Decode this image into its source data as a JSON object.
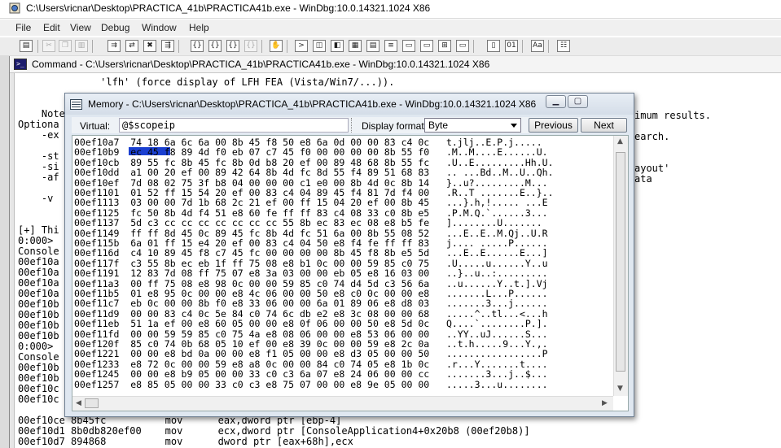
{
  "app": {
    "title": "C:\\Users\\ricnar\\Desktop\\PRACTICA_41b\\PRACTICA41b.exe - WinDbg:10.0.14321.1024 X86"
  },
  "menu": {
    "file": "File",
    "edit": "Edit",
    "view": "View",
    "debug": "Debug",
    "window": "Window",
    "help": "Help"
  },
  "command_window": {
    "title": "Command - C:\\Users\\ricnar\\Desktop\\PRACTICA_41b\\PRACTICA41b.exe - WinDbg:10.0.14321.1024 X86",
    "lines": [
      "              'lfh' (force display of LFH FEA (Vista/Win7/...)).",
      "",
      "",
      "    Note",
      "Optiona",
      "    -ex",
      "",
      "",
      "    -st",
      "    -si",
      "    -af",
      "",
      "    -v",
      "",
      "[+] Thi",
      "0:000>",
      "Console",
      "00ef10a",
      "00ef10a",
      "00ef10a",
      "00ef10a",
      "00ef10b",
      "00ef10b",
      "00ef10b",
      "00ef10b",
      "0:000>",
      "Console",
      "00ef10b",
      "00ef10b",
      "00ef10c",
      "00ef10c",
      "00ef10ce 8b45fc          mov      eax,dword ptr [ebp-4]",
      "00ef10d1 8b0db820ef00    mov      ecx,dword ptr [ConsoleApplication4+0x20b8 (00ef20b8)]",
      "00ef10d7 894868          mov      dword ptr [eax+68h],ecx"
    ],
    "right_fragments": {
      "r1": "imum results.",
      "r2": "earch.",
      "r3": "ayout'",
      "r4": "ata"
    }
  },
  "memory_window": {
    "title": "Memory - C:\\Users\\ricnar\\Desktop\\PRACTICA_41b\\PRACTICA41b.exe - WinDbg:10.0.14321.1024 X86",
    "virtual_label": "Virtual:",
    "virtual_value": "@$scopeip",
    "format_label": "Display format:",
    "format_value": "Byte",
    "previous_label": "Previous",
    "next_label": "Next",
    "rows": [
      "00ef10a7  74 18 6a 6c 6a 00 8b 45 f8 50 e8 6a 0d 00 00 83 c4 0c   t.jlj..E.P.j.....",
      "00ef10b9  ec 45 f8 89 4d f0 eb 07 c7 45 f0 00 00 00 00 8b 55 f0   .M..M....E......U.",
      "00ef10cb  89 55 fc 8b 45 fc 8b 0d b8 20 ef 00 89 48 68 8b 55 fc   .U..E.........Hh.U.",
      "00ef10dd  a1 00 20 ef 00 89 42 64 8b 4d fc 8d 55 f4 89 51 68 83   .. ...Bd..M..U..Qh.",
      "00ef10ef  7d 08 02 75 3f b8 04 00 00 00 c1 e0 00 8b 4d 0c 8b 14   }..u?.........M...",
      "00ef1101  01 52 ff 15 54 20 ef 00 83 c4 04 89 45 f4 81 7d f4 00   .R..T .......E..}..",
      "00ef1113  03 00 00 7d 1b 68 2c 21 ef 00 ff 15 04 20 ef 00 8b 45   ...}.h,!..... ...E",
      "00ef1125  fc 50 8b 4d f4 51 e8 60 fe ff ff 83 c4 08 33 c0 8b e5   .P.M.Q.`......3...",
      "00ef1137  5d c3 cc cc cc cc cc cc cc 55 8b ec 83 ec 08 e8 b5 fe   ]........U.......",
      "00ef1149  ff ff 8d 45 0c 89 45 fc 8b 4d fc 51 6a 00 8b 55 08 52   ...E..E..M.Qj..U.R",
      "00ef115b  6a 01 ff 15 e4 20 ef 00 83 c4 04 50 e8 f4 fe ff ff 83   j.... .....P......",
      "00ef116d  c4 10 89 45 f8 c7 45 fc 00 00 00 00 8b 45 f8 8b e5 5d   ...E..E......E...]",
      "00ef117f  c3 55 8b ec eb 1f ff 75 08 e8 b1 0c 00 00 59 85 c0 75   .U.....u......Y..u",
      "00ef1191  12 83 7d 08 ff 75 07 e8 3a 03 00 00 eb 05 e8 16 03 00   ..}..u..:.........",
      "00ef11a3  00 ff 75 08 e8 98 0c 00 00 59 85 c0 74 d4 5d c3 56 6a   ..u......Y..t.].Vj",
      "00ef11b5  01 e8 95 0c 00 00 e8 4c 06 00 00 50 e8 c0 0c 00 00 e8   .......L...P......",
      "00ef11c7  eb 0c 00 00 8b f0 e8 33 06 00 00 6a 01 89 06 e8 d8 03   .......3...j......",
      "00ef11d9  00 00 83 c4 0c 5e 84 c0 74 6c db e2 e8 3c 08 00 00 68   .....^..tl...<...h",
      "00ef11eb  51 1a ef 00 e8 60 05 00 00 e8 0f 06 00 00 50 e8 5d 0c   Q....`........P.].",
      "00ef11fd  00 00 59 59 85 c0 75 4a e8 08 06 00 00 e8 53 06 00 00   ..YY..uJ......S...",
      "00ef120f  85 c0 74 0b 68 05 10 ef 00 e8 39 0c 00 00 59 e8 2c 0a   ..t.h.....9...Y.,.",
      "00ef1221  00 00 e8 bd 0a 00 00 e8 f1 05 00 00 e8 d3 05 00 00 50   .................P",
      "00ef1233  e8 72 0c 00 00 59 e8 a8 0c 00 00 84 c0 74 05 e8 1b 0c   .r...Y.......t....",
      "00ef1245  00 00 e8 b9 05 00 00 33 c0 c3 6a 07 e8 24 06 00 00 cc   .......3...j..$...",
      "00ef1257  e8 85 05 00 00 33 c0 c3 e8 75 07 00 00 e8 9e 05 00 00   .....3...u........"
    ]
  }
}
